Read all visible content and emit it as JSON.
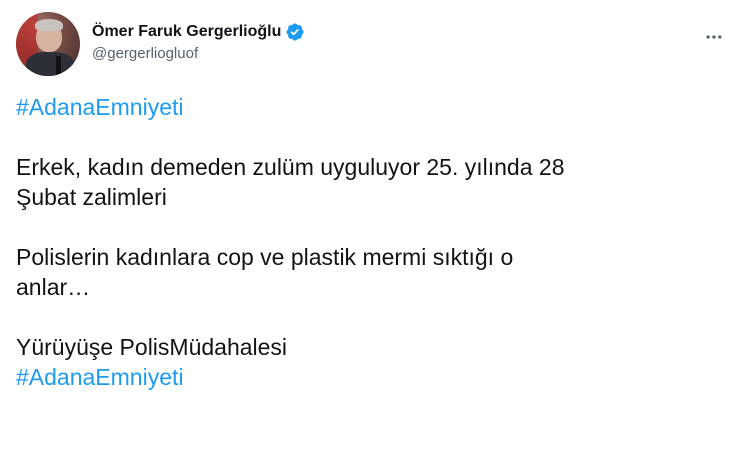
{
  "author": {
    "display_name": "Ömer Faruk Gergerlioğlu",
    "handle": "@gergerliogluof",
    "verified": true,
    "avatar_icon": "profile-photo"
  },
  "header": {
    "more_icon": "more-horizontal-icon"
  },
  "tweet": {
    "hashtag_top": "#AdanaEmniyeti",
    "paragraph1_line1": "Erkek, kadın demeden zulüm uyguluyor 25. yılında 28",
    "paragraph1_line2": "Şubat zalimleri",
    "paragraph2_line1": "Polislerin kadınlara cop ve plastik mermi sıktığı o",
    "paragraph2_line2": "anlar…",
    "paragraph3_line1": "Yürüyüşe PolisMüdahalesi",
    "hashtag_bottom": "#AdanaEmniyeti"
  },
  "colors": {
    "link": "#1d9bf0",
    "text": "#0f1419",
    "secondary": "#536471",
    "verified": "#1d9bf0"
  }
}
